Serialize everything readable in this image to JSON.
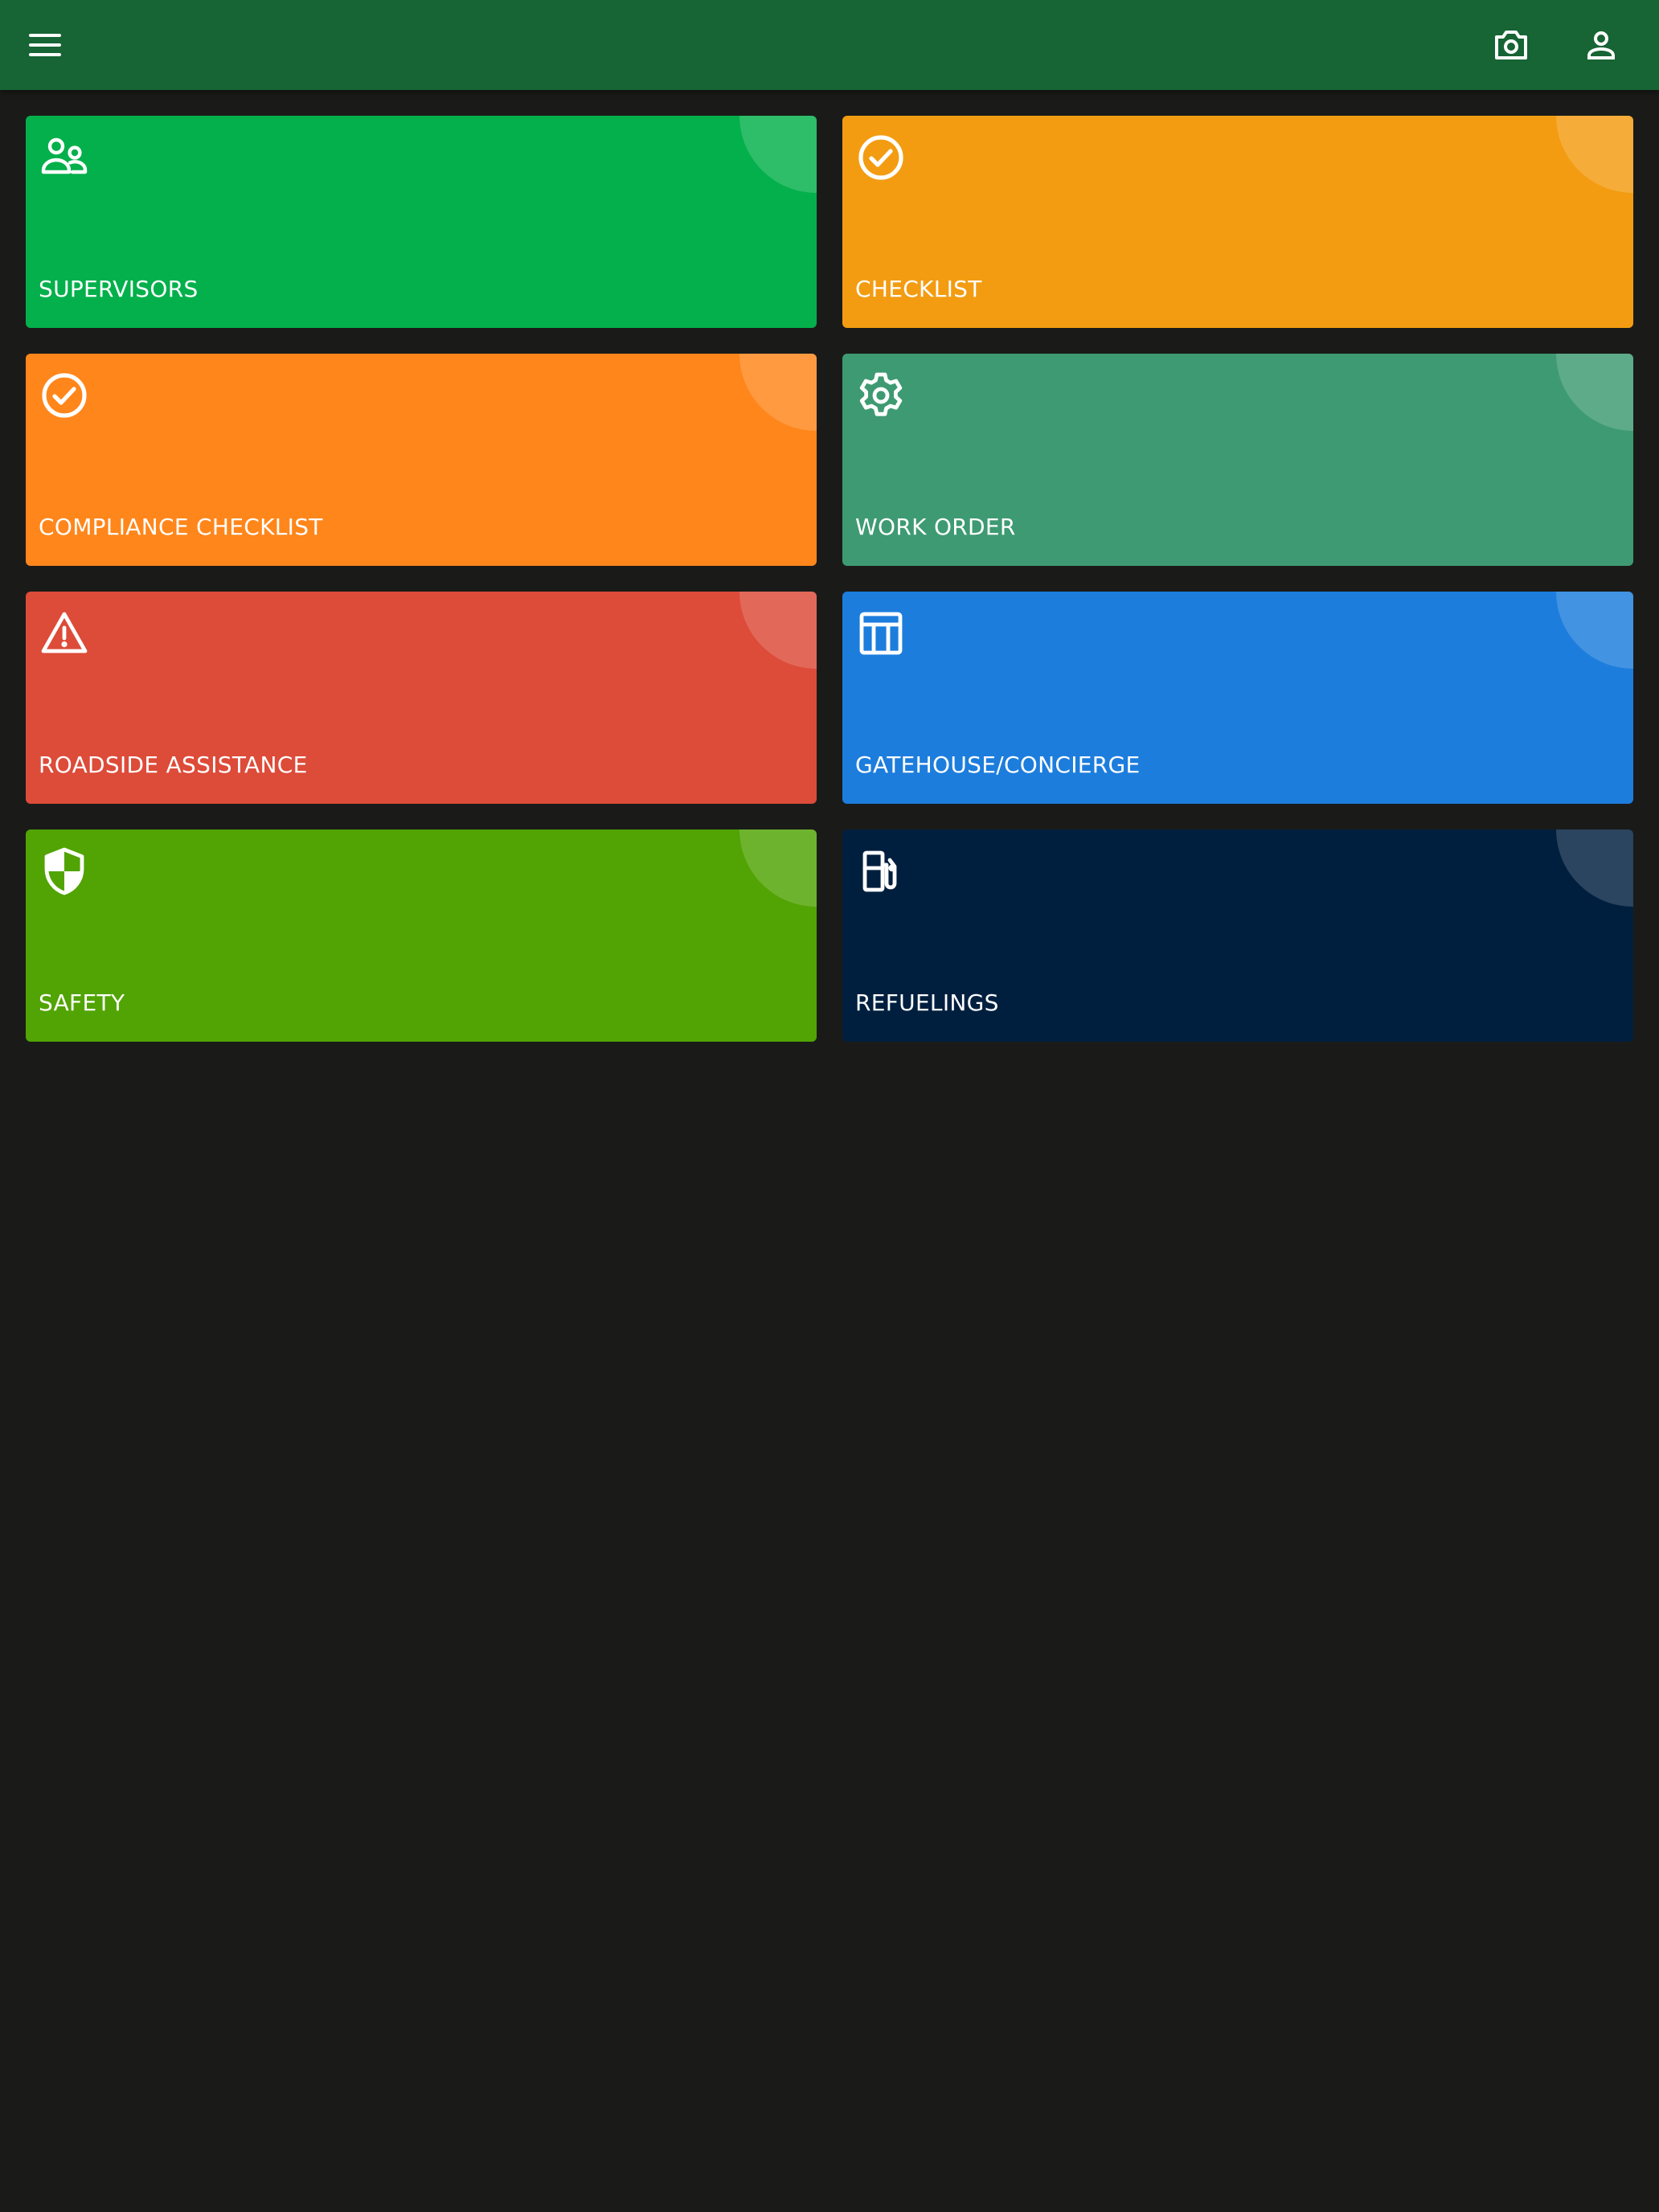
{
  "appbar": {
    "background": "#176434",
    "icons": [
      "menu-icon",
      "camera-icon",
      "account-icon"
    ]
  },
  "tiles": [
    {
      "label": "SUPERVISORS",
      "icon": "supervisor-account-icon",
      "color": "#04b04b"
    },
    {
      "label": "CHECKLIST",
      "icon": "check-circle-icon",
      "color": "#f39c12"
    },
    {
      "label": "COMPLIANCE CHECKLIST",
      "icon": "check-circle-icon",
      "color": "#ff861b"
    },
    {
      "label": "WORK ORDER",
      "icon": "gear-icon",
      "color": "#3e9a72"
    },
    {
      "label": "ROADSIDE ASSISTANCE",
      "icon": "warning-icon",
      "color": "#dd4b39"
    },
    {
      "label": "GATEHOUSE/CONCIERGE",
      "icon": "gatehouse-icon",
      "color": "#1c7ddd"
    },
    {
      "label": "SAFETY",
      "icon": "shield-icon",
      "color": "#51a404"
    },
    {
      "label": "REFUELINGS",
      "icon": "fuel-pump-icon",
      "color": "#001f3f"
    }
  ]
}
